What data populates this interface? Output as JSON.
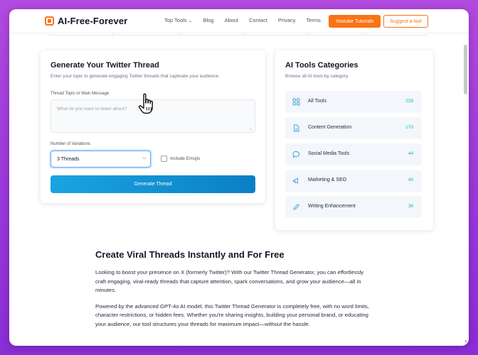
{
  "header": {
    "logo_text": "AI-Free-Forever",
    "nav": [
      {
        "label": "Top Tools",
        "dropdown": true
      },
      {
        "label": "Blog"
      },
      {
        "label": "About"
      },
      {
        "label": "Contact"
      },
      {
        "label": "Privacy"
      },
      {
        "label": "Terms"
      }
    ],
    "primary_button": "Youtube Tutorials",
    "secondary_button": "Suggest a tool"
  },
  "generator": {
    "title": "Generate Your Twitter Thread",
    "subtitle": "Enter your topic to generate engaging Twitter threads that captivate your audience",
    "topic_label": "Thread Topic or Main Message",
    "topic_placeholder": "What do you want to tweet about?",
    "variations_label": "Number of Variations",
    "variations_value": "3 Threads",
    "emoji_label": "Include Emojis",
    "emoji_checked": false,
    "generate_button": "Generate Thread"
  },
  "categories": {
    "title": "AI Tools Categories",
    "subtitle": "Browse all AI tools by category",
    "items": [
      {
        "label": "All Tools",
        "count": "229",
        "icon": "grid-icon"
      },
      {
        "label": "Content Generation",
        "count": "170",
        "icon": "document-icon"
      },
      {
        "label": "Social Media Tools",
        "count": "44",
        "icon": "chat-bubble-icon"
      },
      {
        "label": "Marketing & SEO",
        "count": "40",
        "icon": "megaphone-icon"
      },
      {
        "label": "Writing Enhancement",
        "count": "36",
        "icon": "pencil-icon"
      }
    ]
  },
  "article": {
    "heading": "Create Viral Threads Instantly and For Free",
    "paragraphs": [
      "Looking to boost your presence on X (formerly Twitter)? With our Twitter Thread Generator, you can effortlessly craft engaging, viral-ready threads that capture attention, spark conversations, and grow your audience—all in minutes.",
      "Powered by the advanced GPT-4o AI model, this Twitter Thread Generator is completely free, with no word limits, character restrictions, or hidden fees. Whether you're sharing insights, building your personal brand, or educating your audience, our tool structures your threads for maximum impact—without the hassle."
    ]
  },
  "colors": {
    "accent": "#f97316",
    "button_gradient_start": "#1aa3e2",
    "button_gradient_end": "#0a80c4",
    "count_color": "#14b8a6",
    "background_gradient": "#a43fdc"
  }
}
